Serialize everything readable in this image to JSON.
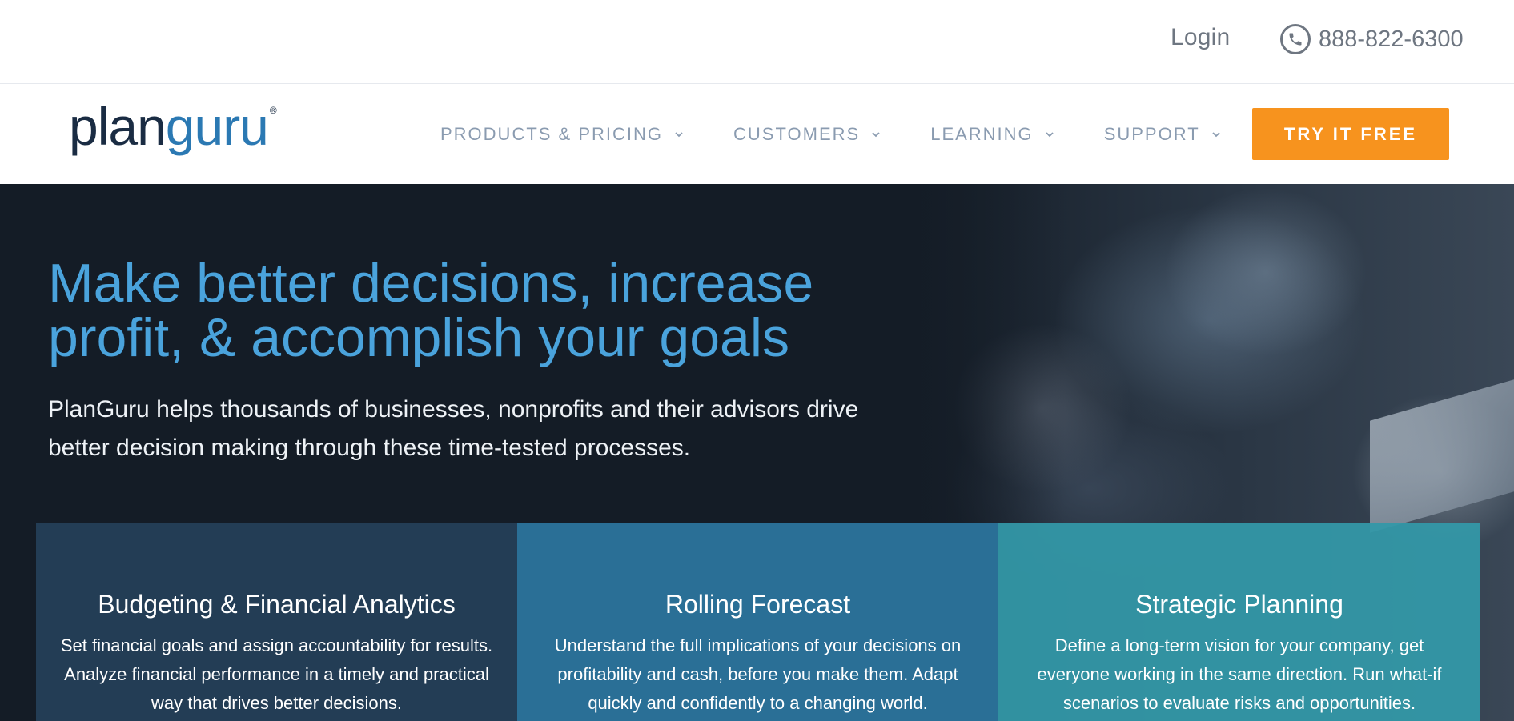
{
  "topbar": {
    "login_label": "Login",
    "phone_icon": "phone-icon",
    "phone_number": "888-822-6300"
  },
  "brand": {
    "logo_part1": "plan",
    "logo_part2": "guru",
    "logo_mark": "®",
    "colors": {
      "dark": "#1a2c43",
      "blue": "#2b79b3"
    }
  },
  "nav": {
    "items": [
      {
        "label": "PRODUCTS & PRICING",
        "icon": "chevron-down-icon"
      },
      {
        "label": "CUSTOMERS",
        "icon": "chevron-down-icon"
      },
      {
        "label": "LEARNING",
        "icon": "chevron-down-icon"
      },
      {
        "label": "SUPPORT",
        "icon": "chevron-down-icon"
      }
    ],
    "cta_label": "TRY IT FREE",
    "cta_color": "#f7931e"
  },
  "hero": {
    "title": "Make better decisions, increase profit, & accomplish your goals",
    "subtitle": "PlanGuru helps thousands of businesses, nonprofits and their advisors drive better decision making through these time-tested processes.",
    "title_color": "#4aa3dc",
    "background_color": "#141c26"
  },
  "cards": [
    {
      "title": "Budgeting & Financial Analytics",
      "description": "Set financial goals and assign accountability for results. Analyze financial performance in a timely and practical way that drives better decisions.",
      "color": "#233d55"
    },
    {
      "title": "Rolling Forecast",
      "description": "Understand the full implications of your decisions on profitability and cash, before you make them. Adapt quickly and confidently to a changing world.",
      "color": "#2a6f96"
    },
    {
      "title": "Strategic Planning",
      "description": "Define a long-term vision for your company, get everyone working in the same direction. Run what-if scenarios to evaluate risks and opportunities.",
      "color": "#3398a8"
    }
  ]
}
